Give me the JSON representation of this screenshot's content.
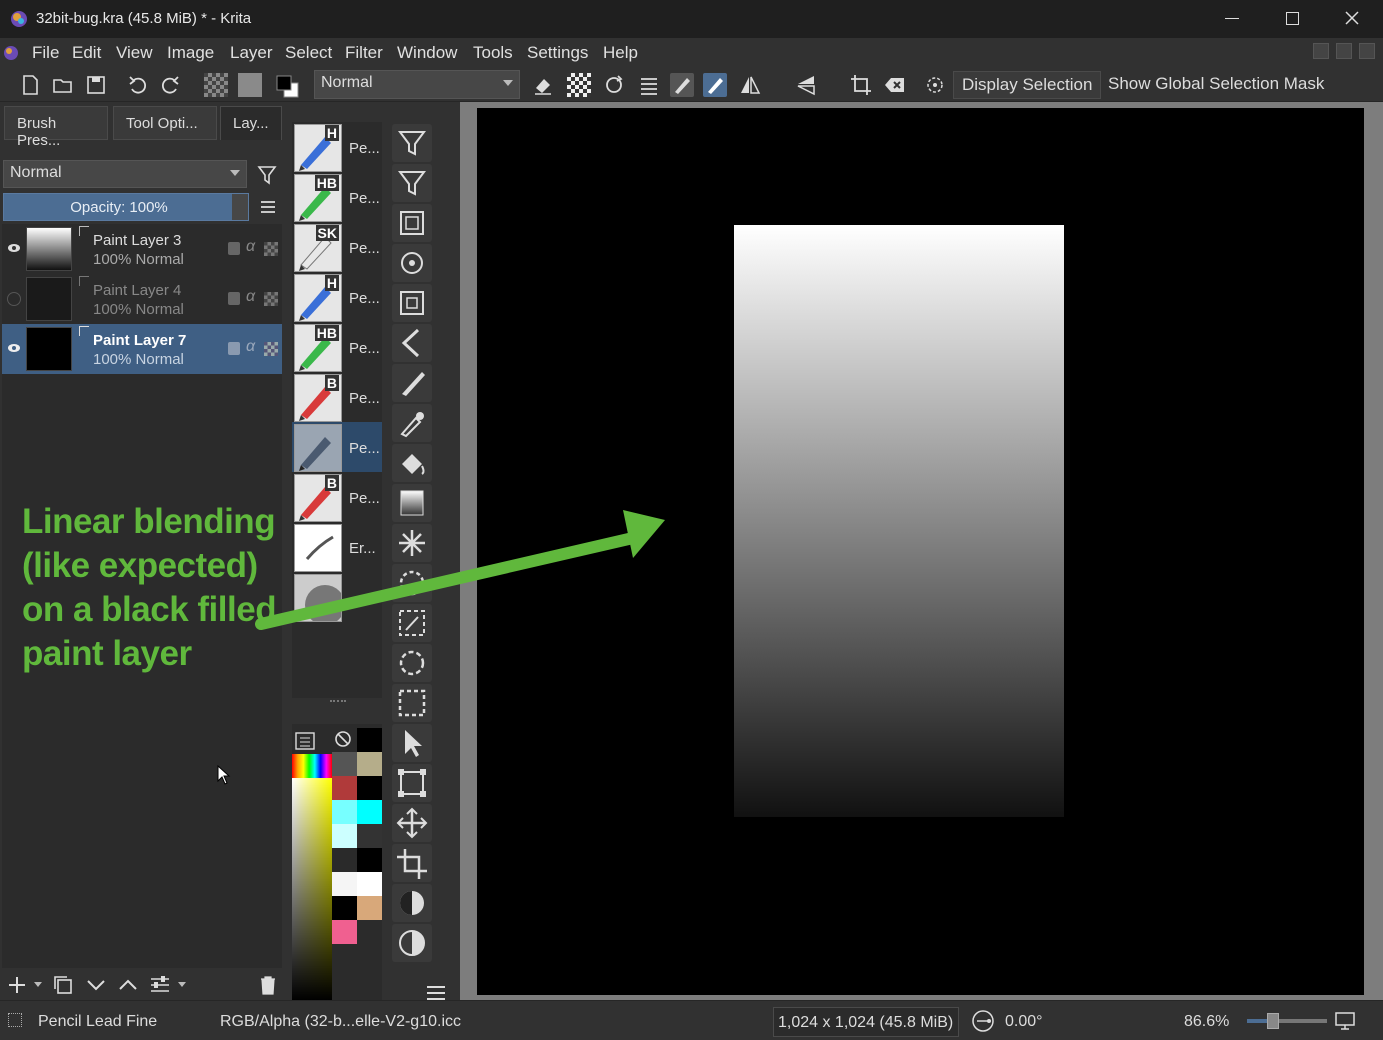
{
  "window": {
    "title": "32bit-bug.kra (45.8 MiB) * - Krita"
  },
  "menu": [
    "File",
    "Edit",
    "View",
    "Image",
    "Layer",
    "Select",
    "Filter",
    "Window",
    "Tools",
    "Settings",
    "Help"
  ],
  "toolbar": {
    "blend_mode": "Normal",
    "display_selection": "Display Selection",
    "show_global_selection_mask": "Show Global Selection Mask"
  },
  "dock_tabs": [
    "Brush Pres...",
    "Tool Opti...",
    "Lay..."
  ],
  "layers": {
    "blend_mode": "Normal",
    "opacity": "Opacity:  100%",
    "items": [
      {
        "name": "Paint Layer 3",
        "sub": "100% Normal",
        "visible": true
      },
      {
        "name": "Paint Layer 4",
        "sub": "100% Normal",
        "visible": false
      },
      {
        "name": "Paint Layer 7",
        "sub": "100% Normal",
        "visible": true
      }
    ]
  },
  "presets": [
    {
      "badge": "H",
      "label": "Pe..."
    },
    {
      "badge": "HB",
      "label": "Pe..."
    },
    {
      "badge": "SK",
      "label": "Pe..."
    },
    {
      "badge": "H",
      "label": "Pe..."
    },
    {
      "badge": "HB",
      "label": "Pe..."
    },
    {
      "badge": "B",
      "label": "Pe..."
    },
    {
      "badge": "",
      "label": "Pe..."
    },
    {
      "badge": "B",
      "label": "Pe..."
    },
    {
      "badge": "",
      "label": "Er..."
    }
  ],
  "annotation": "Linear blending (like expected) on a black filled paint layer",
  "status": {
    "brush": "Pencil Lead Fine",
    "color_profile": "RGB/Alpha (32-b...elle-V2-g10.icc",
    "size": "1,024 x 1,024 (45.8 MiB)",
    "rotation": "0.00°",
    "zoom": "86.6%"
  },
  "colors": {
    "accent": "#3f5f84",
    "annotation_green": "#60b83c"
  }
}
